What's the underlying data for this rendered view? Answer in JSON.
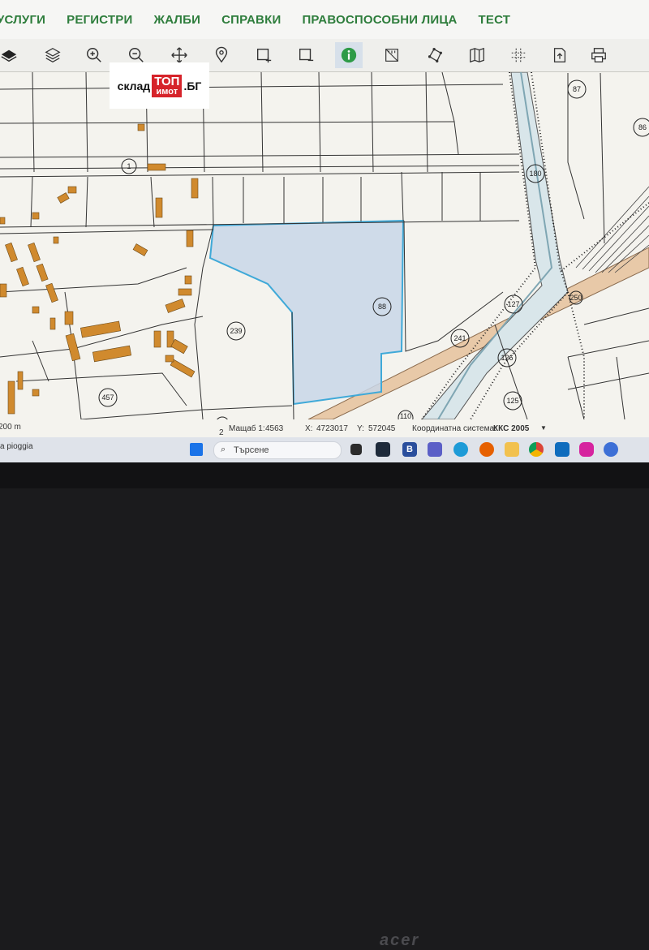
{
  "menu": {
    "items": [
      "УСЛУГИ",
      "РЕГИСТРИ",
      "ЖАЛБИ",
      "СПРАВКИ",
      "ПРАВОСПОСОБНИ ЛИЦА",
      "ТЕСТ"
    ]
  },
  "toolbar": {
    "tools": [
      "layers-icon",
      "layers-stack-icon",
      "zoom-in-icon",
      "zoom-out-icon",
      "pan-icon",
      "location-pin-icon",
      "draw-rectangle-icon",
      "remove-rectangle-icon",
      "info-icon",
      "measure-distance-icon",
      "measure-area-icon",
      "map-icon",
      "grid-icon",
      "export-icon",
      "print-icon"
    ],
    "active": "info-icon"
  },
  "brand": {
    "word1": "склад",
    "box_line1": "ТОП",
    "box_line2": "имот",
    "word2": ".БГ"
  },
  "map": {
    "parcel_labels": [
      "87",
      "86",
      "1",
      "180",
      "88",
      "239",
      "250",
      "127",
      "241",
      "126",
      "125",
      "457",
      "110",
      "2"
    ],
    "selected_parcel": "88",
    "colors": {
      "selected_fill": "#c8d6e8",
      "selected_stroke": "#3fa9d8",
      "building": "#d08a2e",
      "road": "#e8c9a8",
      "map_bg": "#f4f3ee"
    }
  },
  "statusbar": {
    "scale_bar": "200 m",
    "scale_label": "Мащаб 1:",
    "scale_value": "4563",
    "x_label": "X:",
    "x_value": "4723017",
    "y_label": "Y:",
    "y_value": "572045",
    "crs_label": "Координатна система:",
    "crs_value": "ККС 2005"
  },
  "taskbar": {
    "search_placeholder": "Търсене",
    "weather": "a pioggia",
    "apps": [
      "windows-icon",
      "task-view-icon",
      "app-b-icon",
      "teams-icon",
      "edge-icon",
      "firefox-icon",
      "file-explorer-icon",
      "chrome-icon",
      "mail-icon",
      "instagram-icon",
      "phone-link-icon"
    ]
  },
  "bezel": {
    "brand": "acer"
  }
}
